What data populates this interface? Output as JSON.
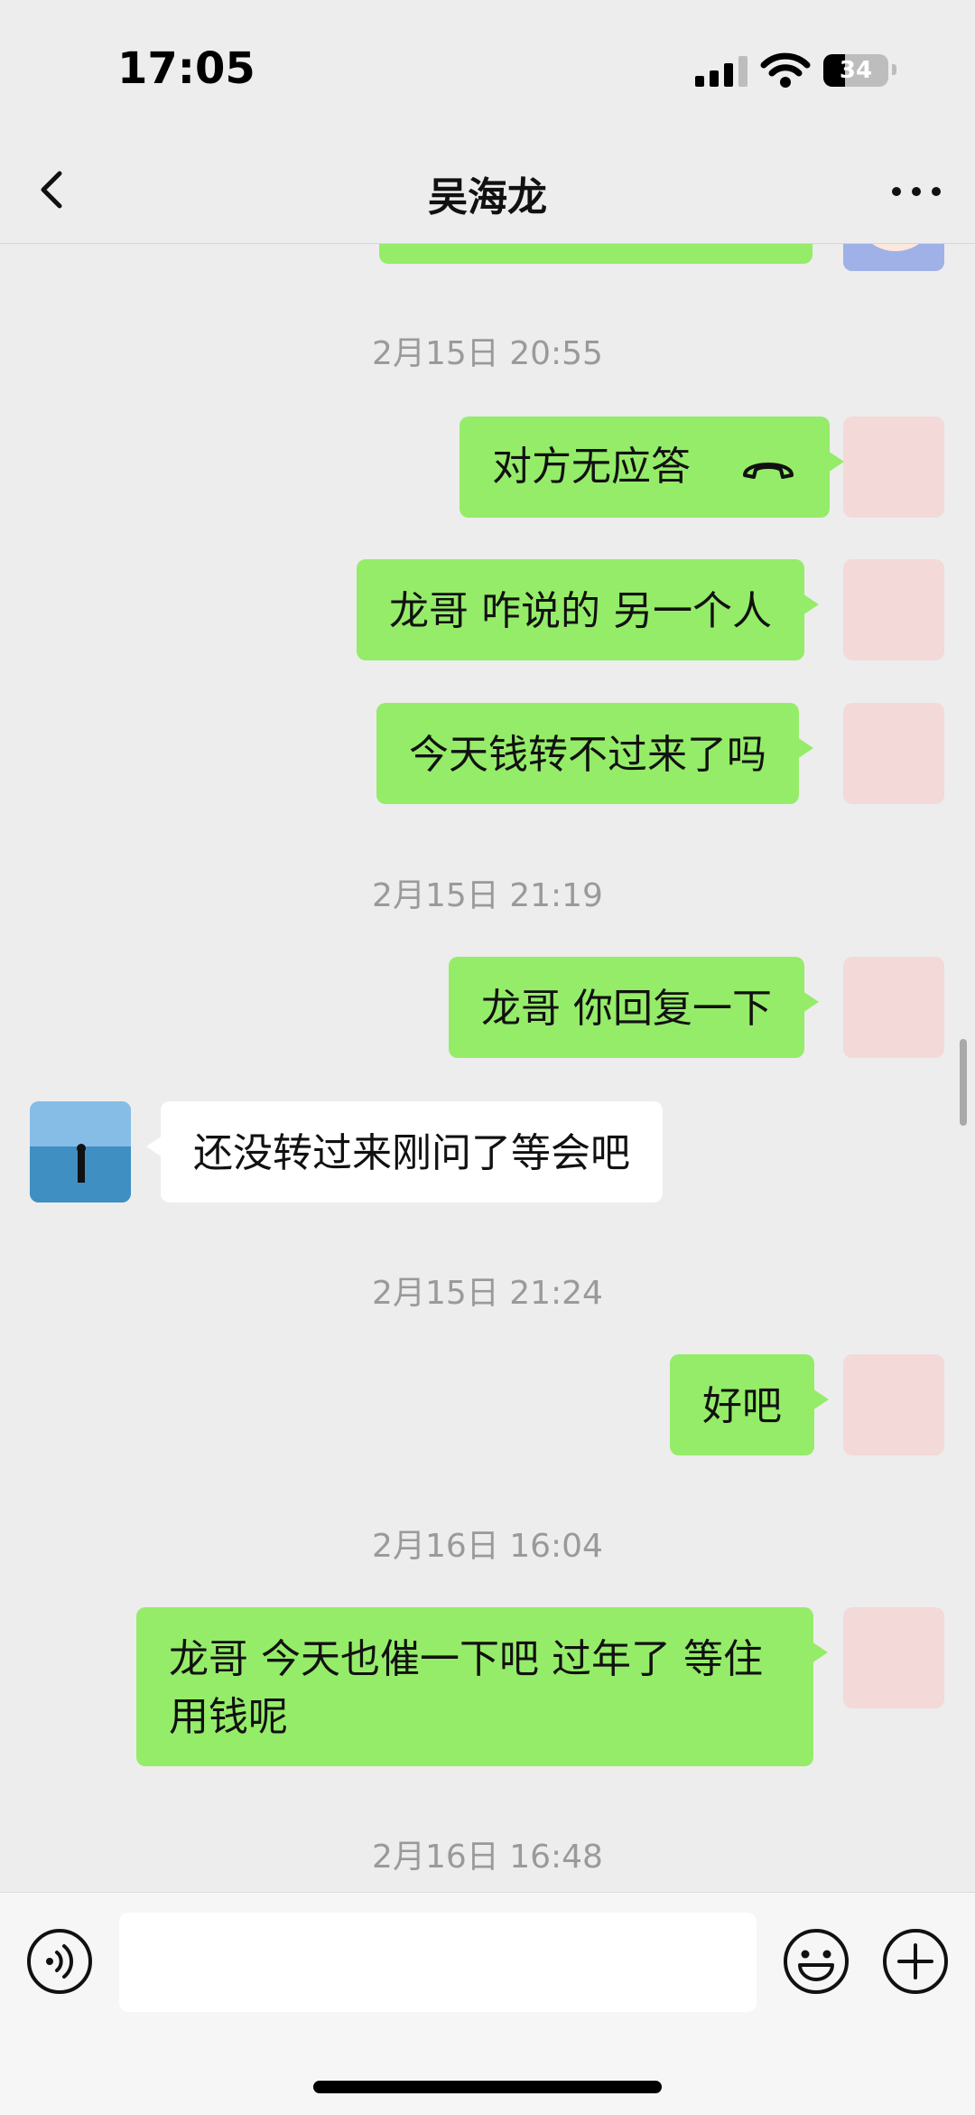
{
  "status_bar": {
    "time": "17:05",
    "battery": "34",
    "battery_level": 0.34
  },
  "nav": {
    "title": "吴海龙"
  },
  "messages": [
    {
      "type": "timestamp",
      "text": "2月15日 20:55"
    },
    {
      "type": "sent",
      "text": "对方无应答",
      "icon": "phone-hangup-icon"
    },
    {
      "type": "sent",
      "text": "龙哥 咋说的 另一个人"
    },
    {
      "type": "sent",
      "text": "今天钱转不过来了吗"
    },
    {
      "type": "timestamp",
      "text": "2月15日 21:19"
    },
    {
      "type": "sent",
      "text": "龙哥 你回复一下"
    },
    {
      "type": "received",
      "text": "还没转过来刚问了等会吧"
    },
    {
      "type": "timestamp",
      "text": "2月15日 21:24"
    },
    {
      "type": "sent",
      "text": "好吧"
    },
    {
      "type": "timestamp",
      "text": "2月16日 16:04"
    },
    {
      "type": "sent",
      "text": "龙哥 今天也催一下吧 过年了 等住用钱呢"
    },
    {
      "type": "timestamp",
      "text": "2月16日 16:48"
    }
  ],
  "input": {
    "value": "",
    "placeholder": ""
  },
  "icons": {
    "back": "chevron-left-icon",
    "more": "more-dots-icon",
    "voice": "voice-icon",
    "emoji": "emoji-icon",
    "plus": "plus-icon"
  },
  "colors": {
    "sent_bubble": "#95ec69",
    "received_bubble": "#ffffff",
    "background": "#ededed"
  }
}
